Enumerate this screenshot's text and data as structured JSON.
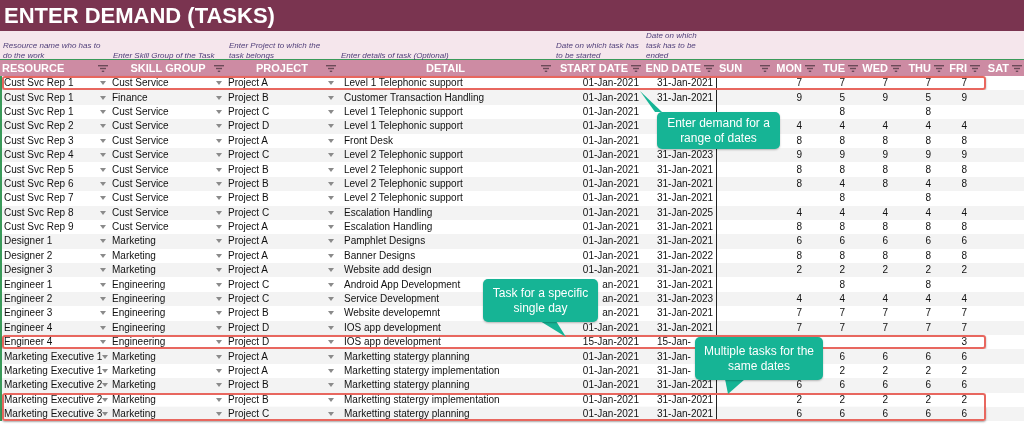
{
  "title": "ENTER DEMAND (TASKS)",
  "notes": [
    "Resource name who has to do the work",
    "Enter Skill Group of the Task",
    "Enter Project to which the task belongs",
    "Enter details of task (Optional)",
    "Date on which task has to be started",
    "Date on which task has to be ended"
  ],
  "columns": [
    "RESOURCE",
    "SKILL GROUP",
    "PROJECT",
    "DETAIL",
    "START DATE",
    "END DATE",
    "SUN",
    "MON",
    "TUE",
    "WED",
    "THU",
    "FRI",
    "SAT"
  ],
  "rows": [
    {
      "resource": "Cust Svc Rep 1",
      "skill_group": "Cust Service",
      "project": "Project A",
      "detail": "Level 1 Telephonic support",
      "start_date": "01-Jan-2021",
      "end_date": "31-Jan-2021",
      "hours": {
        "mon": "7",
        "tue": "7",
        "wed": "7",
        "thu": "7",
        "fri": "7"
      },
      "highlighted": true
    },
    {
      "resource": "Cust Svc Rep 1",
      "skill_group": "Finance",
      "project": "Project B",
      "detail": "Customer Transaction Handling",
      "start_date": "01-Jan-2021",
      "end_date": "31-Jan-2021",
      "hours": {
        "mon": "9",
        "tue": "5",
        "wed": "9",
        "thu": "5",
        "fri": "9"
      },
      "highlighted": false
    },
    {
      "resource": "Cust Svc Rep 1",
      "skill_group": "Cust Service",
      "project": "Project C",
      "detail": "Level 1 Telephonic support",
      "start_date": "01-Jan-2021",
      "hours": {
        "tue": "8",
        "thu": "8"
      },
      "highlighted": false
    },
    {
      "resource": "Cust Svc Rep 2",
      "skill_group": "Cust Service",
      "project": "Project D",
      "detail": "Level 1 Telephonic support",
      "start_date": "01-Jan-2021",
      "hours": {
        "mon": "4",
        "tue": "4",
        "wed": "4",
        "thu": "4",
        "fri": "4"
      },
      "highlighted": false
    },
    {
      "resource": "Cust Svc Rep 3",
      "skill_group": "Cust Service",
      "project": "Project A",
      "detail": "Front Desk",
      "start_date": "01-Jan-2021",
      "hours": {
        "mon": "8",
        "tue": "8",
        "wed": "8",
        "thu": "8",
        "fri": "8"
      },
      "highlighted": false
    },
    {
      "resource": "Cust Svc Rep 4",
      "skill_group": "Cust Service",
      "project": "Project C",
      "detail": "Level 2 Telephonic support",
      "start_date": "01-Jan-2021",
      "end_date": "31-Jan-2023",
      "hours": {
        "mon": "9",
        "tue": "9",
        "wed": "9",
        "thu": "9",
        "fri": "9"
      },
      "highlighted": false
    },
    {
      "resource": "Cust Svc Rep 5",
      "skill_group": "Cust Service",
      "project": "Project B",
      "detail": "Level 2 Telephonic support",
      "start_date": "01-Jan-2021",
      "end_date": "31-Jan-2021",
      "hours": {
        "mon": "8",
        "tue": "8",
        "wed": "8",
        "thu": "8",
        "fri": "8"
      },
      "highlighted": false
    },
    {
      "resource": "Cust Svc Rep 6",
      "skill_group": "Cust Service",
      "project": "Project B",
      "detail": "Level 2 Telephonic support",
      "start_date": "01-Jan-2021",
      "end_date": "31-Jan-2021",
      "hours": {
        "mon": "8",
        "tue": "4",
        "wed": "8",
        "thu": "4",
        "fri": "8"
      },
      "highlighted": false
    },
    {
      "resource": "Cust Svc Rep 7",
      "skill_group": "Cust Service",
      "project": "Project B",
      "detail": "Level 2 Telephonic support",
      "start_date": "01-Jan-2021",
      "end_date": "31-Jan-2021",
      "hours": {
        "tue": "8",
        "thu": "8"
      },
      "highlighted": false
    },
    {
      "resource": "Cust Svc Rep 8",
      "skill_group": "Cust Service",
      "project": "Project C",
      "detail": "Escalation Handling",
      "start_date": "01-Jan-2021",
      "end_date": "31-Jan-2025",
      "hours": {
        "mon": "4",
        "tue": "4",
        "wed": "4",
        "thu": "4",
        "fri": "4"
      },
      "highlighted": false
    },
    {
      "resource": "Cust Svc Rep 9",
      "skill_group": "Cust Service",
      "project": "Project A",
      "detail": "Escalation Handling",
      "start_date": "01-Jan-2021",
      "end_date": "31-Jan-2021",
      "hours": {
        "mon": "8",
        "tue": "8",
        "wed": "8",
        "thu": "8",
        "fri": "8"
      },
      "highlighted": false
    },
    {
      "resource": "Designer 1",
      "skill_group": "Marketing",
      "project": "Project A",
      "detail": "Pamphlet Designs",
      "start_date": "01-Jan-2021",
      "end_date": "31-Jan-2021",
      "hours": {
        "mon": "6",
        "tue": "6",
        "wed": "6",
        "thu": "6",
        "fri": "6"
      },
      "highlighted": false
    },
    {
      "resource": "Designer 2",
      "skill_group": "Marketing",
      "project": "Project A",
      "detail": "Banner Designs",
      "start_date": "01-Jan-2021",
      "end_date": "31-Jan-2022",
      "hours": {
        "mon": "8",
        "tue": "8",
        "wed": "8",
        "thu": "8",
        "fri": "8"
      },
      "highlighted": false
    },
    {
      "resource": "Designer 3",
      "skill_group": "Marketing",
      "project": "Project A",
      "detail": "Website add design",
      "start_date": "01-Jan-2021",
      "end_date": "31-Jan-2021",
      "hours": {
        "mon": "2",
        "tue": "2",
        "wed": "2",
        "thu": "2",
        "fri": "2"
      },
      "highlighted": false
    },
    {
      "resource": "Engineer 1",
      "skill_group": "Engineering",
      "project": "Project C",
      "detail": "Android App Development",
      "start_date": "an-2021",
      "end_date": "31-Jan-2021",
      "hours": {
        "tue": "8",
        "thu": "8"
      },
      "highlighted": false
    },
    {
      "resource": "Engineer 2",
      "skill_group": "Engineering",
      "project": "Project C",
      "detail": "Service Development",
      "start_date": "an-2021",
      "end_date": "31-Jan-2023",
      "hours": {
        "mon": "4",
        "tue": "4",
        "wed": "4",
        "thu": "4",
        "fri": "4"
      },
      "highlighted": false
    },
    {
      "resource": "Engineer 3",
      "skill_group": "Engineering",
      "project": "Project B",
      "detail": "Website developemnt",
      "start_date": "an-2021",
      "end_date": "31-Jan-2021",
      "hours": {
        "mon": "7",
        "tue": "7",
        "wed": "7",
        "thu": "7",
        "fri": "7"
      },
      "highlighted": false
    },
    {
      "resource": "Engineer 4",
      "skill_group": "Engineering",
      "project": "Project D",
      "detail": "IOS app development",
      "start_date": "01-Jan-2021",
      "end_date": "31-Jan-2021",
      "hours": {
        "mon": "7",
        "tue": "7",
        "wed": "7",
        "thu": "7",
        "fri": "7"
      },
      "highlighted": false
    },
    {
      "resource": "Engineer 4",
      "skill_group": "Engineering",
      "project": "Project D",
      "detail": "IOS app development",
      "start_date": "15-Jan-2021",
      "end_date": "15-Jan-",
      "hours": {
        "fri": "3"
      },
      "highlighted": true
    },
    {
      "resource": "Marketing Executive 1",
      "skill_group": "Marketing",
      "project": "Project A",
      "detail": "Marketting statergy planning",
      "start_date": "01-Jan-2021",
      "end_date": "31-Jan-",
      "hours": {
        "tue": "6",
        "wed": "6",
        "thu": "6",
        "fri": "6"
      },
      "highlighted": false
    },
    {
      "resource": "Marketing Executive 1",
      "skill_group": "Marketing",
      "project": "Project A",
      "detail": "Marketting statergy implementation",
      "start_date": "01-Jan-2021",
      "end_date": "31-Jan-",
      "hours": {
        "tue": "2",
        "wed": "2",
        "thu": "2",
        "fri": "2"
      },
      "highlighted": false
    },
    {
      "resource": "Marketing Executive 2",
      "skill_group": "Marketing",
      "project": "Project B",
      "detail": "Marketting statergy planning",
      "start_date": "01-Jan-2021",
      "end_date": "31-Jan-2021",
      "hours": {
        "mon": "6",
        "tue": "6",
        "wed": "6",
        "thu": "6",
        "fri": "6"
      },
      "highlighted": false
    },
    {
      "resource": "Marketing Executive 2",
      "skill_group": "Marketing",
      "project": "Project B",
      "detail": "Marketting statergy implementation",
      "start_date": "01-Jan-2021",
      "end_date": "31-Jan-2021",
      "hours": {
        "mon": "2",
        "tue": "2",
        "wed": "2",
        "thu": "2",
        "fri": "2"
      },
      "highlighted": true
    },
    {
      "resource": "Marketing Executive 3",
      "skill_group": "Marketing",
      "project": "Project C",
      "detail": "Marketting statergy planning",
      "start_date": "01-Jan-2021",
      "end_date": "31-Jan-2021",
      "hours": {
        "mon": "6",
        "tue": "6",
        "wed": "6",
        "thu": "6",
        "fri": "6"
      },
      "highlighted": true
    }
  ],
  "callouts": [
    "Enter demand for a range of dates",
    "Task for a specific single day",
    "Multiple tasks for the same dates"
  ]
}
